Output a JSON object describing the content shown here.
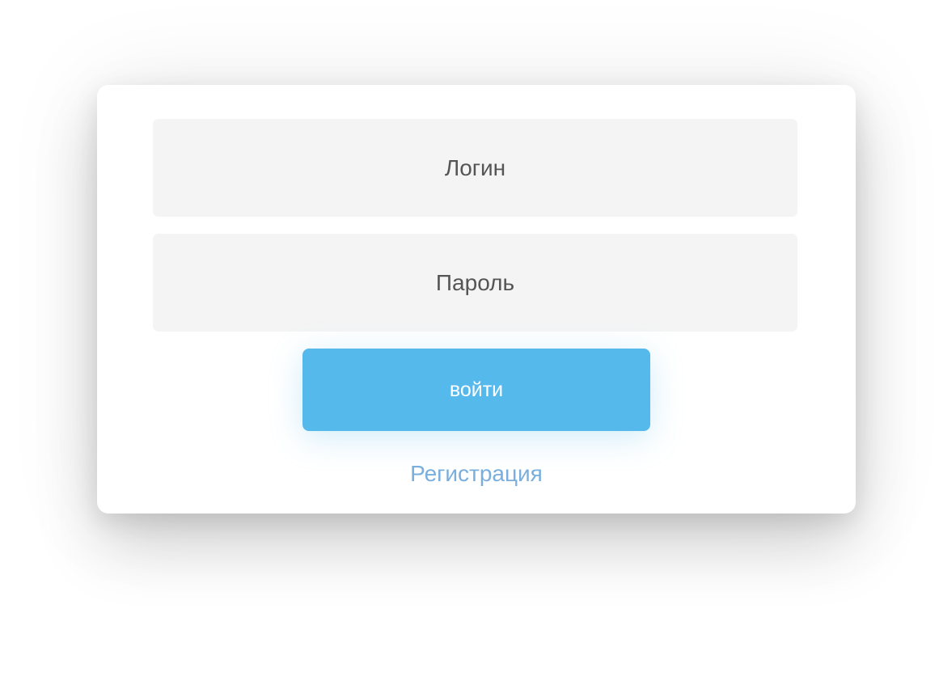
{
  "login_form": {
    "login_placeholder": "Логин",
    "password_placeholder": "Пароль",
    "submit_label": "войти",
    "register_link": "Регистрация"
  },
  "colors": {
    "field_background": "#f4f4f4",
    "button_background": "#56b9ec",
    "button_text": "#ffffff",
    "link_text": "#7aaedc",
    "placeholder_text": "#555555"
  }
}
